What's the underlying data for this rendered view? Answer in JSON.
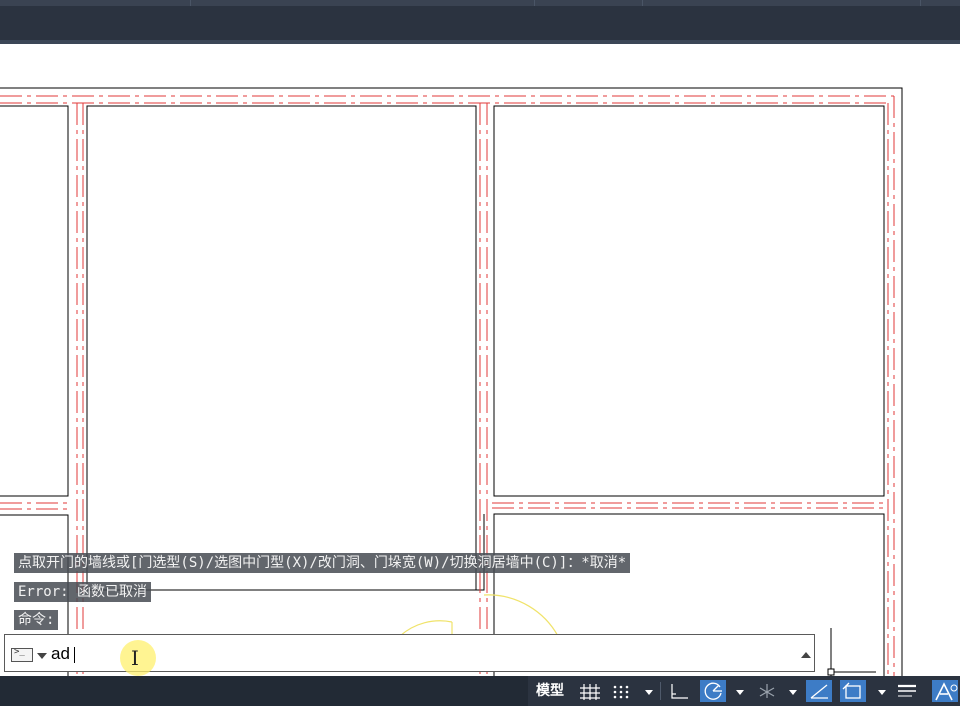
{
  "command_history": [
    "点取开门的墙线或[门选型(S)/选图中门型(X)/改门洞、门垛宽(W)/切换洞居墙中(C)]：*取消*",
    "Error: 函数已取消",
    "命令:"
  ],
  "command_input": {
    "value": "ad",
    "icon": "terminal-icon"
  },
  "status_bar": {
    "model_label": "模型",
    "icons": [
      "grid-icon",
      "snap-icon",
      "ortho-icon",
      "polar-icon",
      "isometric-icon",
      "osnap-icon",
      "object-tracking-icon",
      "lineweight-icon",
      "annotation-icon"
    ],
    "accent_color": "#3d7cc6"
  },
  "colors": {
    "background": "#ffffff",
    "topbar": "#2b3340",
    "wall_line": "#000000",
    "axis_line": "#e23a3a",
    "door_arc": "#f0e36a"
  }
}
